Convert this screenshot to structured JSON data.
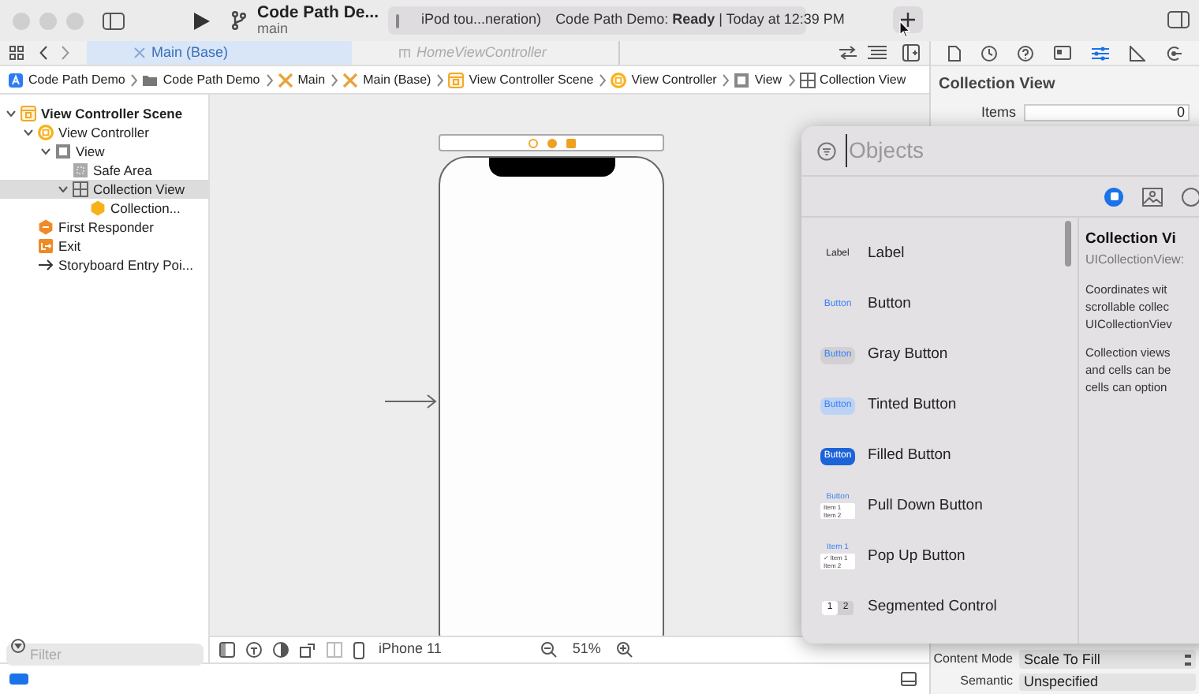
{
  "toolbar": {
    "project": "Code Path De...",
    "branch": "main",
    "scheme": "iPod tou...neration)",
    "status": "Code Path Demo: **Ready** | Today at 12:39 PM"
  },
  "tabs": [
    {
      "label": "Main (Base)",
      "selected": true
    },
    {
      "label": "HomeViewController",
      "selected": false
    }
  ],
  "breadcrumb": [
    {
      "label": "Code Path Demo",
      "kind": "app"
    },
    {
      "label": "Code Path Demo",
      "kind": "folder"
    },
    {
      "label": "Main",
      "kind": "storyboard"
    },
    {
      "label": "Main (Base)",
      "kind": "storyboard"
    },
    {
      "label": "View Controller Scene",
      "kind": "scene"
    },
    {
      "label": "View Controller",
      "kind": "controller"
    },
    {
      "label": "View",
      "kind": "view"
    },
    {
      "label": "Collection View",
      "kind": "collection"
    }
  ],
  "navigator": {
    "tree": [
      {
        "label": "View Controller Scene",
        "kind": "scene",
        "expanded": true,
        "selected": false,
        "children": [
          {
            "label": "View Controller",
            "kind": "controller",
            "expanded": true,
            "selected": false,
            "children": [
              {
                "label": "View",
                "kind": "view",
                "expanded": true,
                "selected": false,
                "children": [
                  {
                    "label": "Safe Area",
                    "kind": "safe",
                    "selected": false
                  },
                  {
                    "label": "Collection View",
                    "kind": "collection",
                    "expanded": true,
                    "selected": true,
                    "children": [
                      {
                        "label": "Collection...",
                        "kind": "cell",
                        "selected": false
                      }
                    ]
                  }
                ]
              }
            ]
          },
          {
            "label": "First Responder",
            "kind": "responder",
            "selected": false
          },
          {
            "label": "Exit",
            "kind": "exit",
            "selected": false
          },
          {
            "label": "Storyboard Entry Poi...",
            "kind": "entry",
            "selected": false
          }
        ]
      }
    ],
    "filter": {
      "placeholder": "Filter"
    }
  },
  "canvas_bar": {
    "device": "iPhone 11",
    "zoom": "51%"
  },
  "inspector": {
    "title": "Collection View",
    "items_label": "Items",
    "items_value": "0",
    "content_mode_label": "Content Mode",
    "content_mode_value": "Scale To Fill",
    "semantic_label": "Semantic",
    "semantic_value": "Unspecified"
  },
  "library": {
    "placeholder": "Objects",
    "items": [
      {
        "label": "Label",
        "kind": "label",
        "preview": [
          "Label"
        ]
      },
      {
        "label": "Button",
        "kind": "plain",
        "preview": [
          "Button"
        ]
      },
      {
        "label": "Gray Button",
        "kind": "gray",
        "preview": [
          "Button"
        ]
      },
      {
        "label": "Tinted Button",
        "kind": "tinted",
        "preview": [
          "Button"
        ]
      },
      {
        "label": "Filled Button",
        "kind": "filled",
        "preview": [
          "Button"
        ]
      },
      {
        "label": "Pull Down Button",
        "kind": "menu",
        "preview": [
          "Button",
          "Item 1",
          "Item 2"
        ]
      },
      {
        "label": "Pop Up Button",
        "kind": "menu",
        "preview": [
          "Item 1",
          "✓ Item 1",
          "Item 2"
        ]
      },
      {
        "label": "Segmented Control",
        "kind": "segmented",
        "preview": [
          "1",
          "2"
        ]
      }
    ],
    "detail": {
      "title": "Collection Vi",
      "subtitle": "UICollectionView:",
      "paragraphs": [
        "Coordinates wit\nscrollable collec\nUICollectionViev",
        "Collection views\nand cells can be\ncells can option"
      ]
    }
  }
}
